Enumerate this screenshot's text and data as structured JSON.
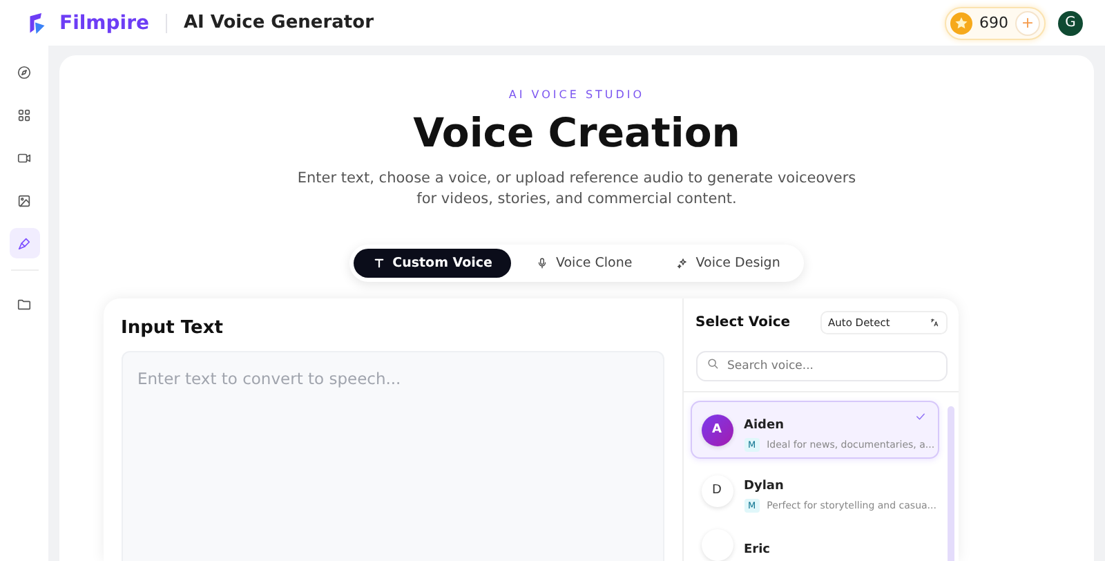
{
  "header": {
    "brand": "Filmpire",
    "page_title": "AI Voice Generator",
    "credits": "690",
    "add_label": "+",
    "avatar": "G"
  },
  "sidebar": {
    "items": [
      {
        "kind": "explore",
        "selected": false
      },
      {
        "kind": "apps",
        "selected": false
      },
      {
        "kind": "video",
        "selected": false
      },
      {
        "kind": "image",
        "selected": false
      },
      {
        "kind": "voice",
        "selected": true
      },
      {
        "kind": "folder",
        "selected": false
      }
    ]
  },
  "hero": {
    "eyebrow": "AI VOICE STUDIO",
    "title": "Voice Creation",
    "description": "Enter text, choose a voice, or upload reference audio to generate voiceovers for videos, stories, and commercial content."
  },
  "tabs": [
    {
      "label": "Custom Voice",
      "selected": true
    },
    {
      "label": "Voice Clone",
      "selected": false
    },
    {
      "label": "Voice Design",
      "selected": false
    }
  ],
  "input": {
    "heading": "Input Text",
    "placeholder": "Enter text to convert to speech..."
  },
  "voices_panel": {
    "heading": "Select Voice",
    "language": "Auto Detect",
    "search_placeholder": "Search voice...",
    "voices": [
      {
        "avatar": "A",
        "name": "Aiden",
        "tag": "M",
        "description": "Ideal for news, documentaries, a...",
        "selected": true
      },
      {
        "avatar": "D",
        "name": "Dylan",
        "tag": "M",
        "description": "Perfect for storytelling and casua...",
        "selected": false
      },
      {
        "name": "Eric",
        "selected": false
      }
    ]
  }
}
